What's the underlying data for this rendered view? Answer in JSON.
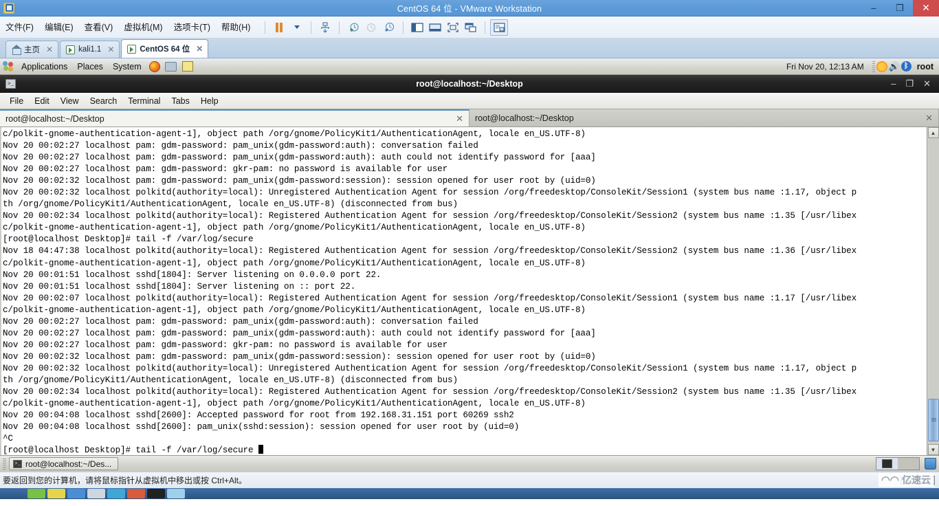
{
  "vmware": {
    "window_title": "CentOS 64 位 - VMware Workstation",
    "app_icon": "vmware-app-icon",
    "window_buttons": {
      "minimize": "–",
      "maximize": "❐",
      "close": "✕"
    },
    "menu": [
      {
        "label": "文件(F)",
        "name": "menu-file"
      },
      {
        "label": "编辑(E)",
        "name": "menu-edit"
      },
      {
        "label": "查看(V)",
        "name": "menu-view"
      },
      {
        "label": "虚拟机(M)",
        "name": "menu-vm"
      },
      {
        "label": "选项卡(T)",
        "name": "menu-tabs"
      },
      {
        "label": "帮助(H)",
        "name": "menu-help"
      }
    ],
    "toolbar": [
      {
        "name": "suspend-button",
        "icon": "pause-icon"
      },
      {
        "name": "power-dropdown",
        "icon": "chevron-down-icon"
      },
      {
        "name": "manage-snapshot-button",
        "icon": "snapshot-manage-icon"
      },
      {
        "name": "take-snapshot-button",
        "icon": "snapshot-add-icon"
      },
      {
        "name": "revert-snapshot-button",
        "icon": "snapshot-revert-icon"
      },
      {
        "name": "snapshot-manager-button",
        "icon": "snapshot-manager-icon"
      },
      {
        "name": "show-sidebar-button",
        "icon": "sidebar-toggle-icon"
      },
      {
        "name": "show-thumbnail-bar-button",
        "icon": "thumbnail-bar-icon"
      },
      {
        "name": "fullscreen-button",
        "icon": "fullscreen-icon"
      },
      {
        "name": "unity-mode-button",
        "icon": "unity-mode-icon"
      },
      {
        "name": "console-view-button",
        "icon": "console-view-icon"
      }
    ],
    "tabs": [
      {
        "label": "主页",
        "icon": "home-icon",
        "active": false,
        "closable": true
      },
      {
        "label": "kali1.1",
        "icon": "vm-icon",
        "active": false,
        "closable": true
      },
      {
        "label": "CentOS 64 位",
        "icon": "vm-icon",
        "active": true,
        "closable": true
      }
    ],
    "status_text": "要返回到您的计算机，请将鼠标指针从虚拟机中移出或按 Ctrl+Alt。",
    "status_icons": [
      "hard-disk-icon",
      "cd-dvd-icon",
      "network-adapter-icon"
    ]
  },
  "gnome_panel": {
    "menus": [
      "Applications",
      "Places",
      "System"
    ],
    "launchers": [
      "firefox-icon",
      "help-icon",
      "text-editor-icon"
    ],
    "clock": "Fri Nov 20, 12:13 AM",
    "tray": [
      "brightness-icon",
      "volume-icon",
      "bluetooth-icon"
    ],
    "user": "root"
  },
  "terminal": {
    "window_title": "root@localhost:~/Desktop",
    "icon": "terminal-icon",
    "window_buttons": {
      "minimize": "–",
      "maximize": "❐",
      "close": "✕"
    },
    "menu": [
      "File",
      "Edit",
      "View",
      "Search",
      "Terminal",
      "Tabs",
      "Help"
    ],
    "tabs": [
      {
        "label": "root@localhost:~/Desktop",
        "active": true,
        "close": "✕"
      },
      {
        "label": "root@localhost:~/Desktop",
        "active": false,
        "close": "✕"
      }
    ],
    "output_lines": [
      "c/polkit-gnome-authentication-agent-1], object path /org/gnome/PolicyKit1/AuthenticationAgent, locale en_US.UTF-8)",
      "Nov 20 00:02:27 localhost pam: gdm-password: pam_unix(gdm-password:auth): conversation failed",
      "Nov 20 00:02:27 localhost pam: gdm-password: pam_unix(gdm-password:auth): auth could not identify password for [aaa]",
      "Nov 20 00:02:27 localhost pam: gdm-password: gkr-pam: no password is available for user",
      "Nov 20 00:02:32 localhost pam: gdm-password: pam_unix(gdm-password:session): session opened for user root by (uid=0)",
      "Nov 20 00:02:32 localhost polkitd(authority=local): Unregistered Authentication Agent for session /org/freedesktop/ConsoleKit/Session1 (system bus name :1.17, object p",
      "th /org/gnome/PolicyKit1/AuthenticationAgent, locale en_US.UTF-8) (disconnected from bus)",
      "Nov 20 00:02:34 localhost polkitd(authority=local): Registered Authentication Agent for session /org/freedesktop/ConsoleKit/Session2 (system bus name :1.35 [/usr/libex",
      "c/polkit-gnome-authentication-agent-1], object path /org/gnome/PolicyKit1/AuthenticationAgent, locale en_US.UTF-8)",
      "[root@localhost Desktop]# tail -f /var/log/secure",
      "Nov 18 04:47:38 localhost polkitd(authority=local): Registered Authentication Agent for session /org/freedesktop/ConsoleKit/Session2 (system bus name :1.36 [/usr/libex",
      "c/polkit-gnome-authentication-agent-1], object path /org/gnome/PolicyKit1/AuthenticationAgent, locale en_US.UTF-8)",
      "Nov 20 00:01:51 localhost sshd[1804]: Server listening on 0.0.0.0 port 22.",
      "Nov 20 00:01:51 localhost sshd[1804]: Server listening on :: port 22.",
      "Nov 20 00:02:07 localhost polkitd(authority=local): Registered Authentication Agent for session /org/freedesktop/ConsoleKit/Session1 (system bus name :1.17 [/usr/libex",
      "c/polkit-gnome-authentication-agent-1], object path /org/gnome/PolicyKit1/AuthenticationAgent, locale en_US.UTF-8)",
      "Nov 20 00:02:27 localhost pam: gdm-password: pam_unix(gdm-password:auth): conversation failed",
      "Nov 20 00:02:27 localhost pam: gdm-password: pam_unix(gdm-password:auth): auth could not identify password for [aaa]",
      "Nov 20 00:02:27 localhost pam: gdm-password: gkr-pam: no password is available for user",
      "Nov 20 00:02:32 localhost pam: gdm-password: pam_unix(gdm-password:session): session opened for user root by (uid=0)",
      "Nov 20 00:02:32 localhost polkitd(authority=local): Unregistered Authentication Agent for session /org/freedesktop/ConsoleKit/Session1 (system bus name :1.17, object p",
      "th /org/gnome/PolicyKit1/AuthenticationAgent, locale en_US.UTF-8) (disconnected from bus)",
      "Nov 20 00:02:34 localhost polkitd(authority=local): Registered Authentication Agent for session /org/freedesktop/ConsoleKit/Session2 (system bus name :1.35 [/usr/libex",
      "c/polkit-gnome-authentication-agent-1], object path /org/gnome/PolicyKit1/AuthenticationAgent, locale en_US.UTF-8)",
      "Nov 20 00:04:08 localhost sshd[2600]: Accepted password for root from 192.168.31.151 port 60269 ssh2",
      "Nov 20 00:04:08 localhost sshd[2600]: pam_unix(sshd:session): session opened for user root by (uid=0)",
      "^C"
    ],
    "prompt_line": "[root@localhost Desktop]# tail -f /var/log/secure ",
    "scrollbar": {
      "up_arrow": "▲",
      "down_arrow": "▼"
    }
  },
  "gnome_bottom": {
    "task_label": "root@localhost:~/Des...",
    "task_icon": "terminal-icon",
    "workspace_switcher": "workspace-switcher",
    "trash_icon": "trash-icon"
  },
  "watermark": {
    "logo": "亿速云-logo",
    "text": "亿速云"
  }
}
